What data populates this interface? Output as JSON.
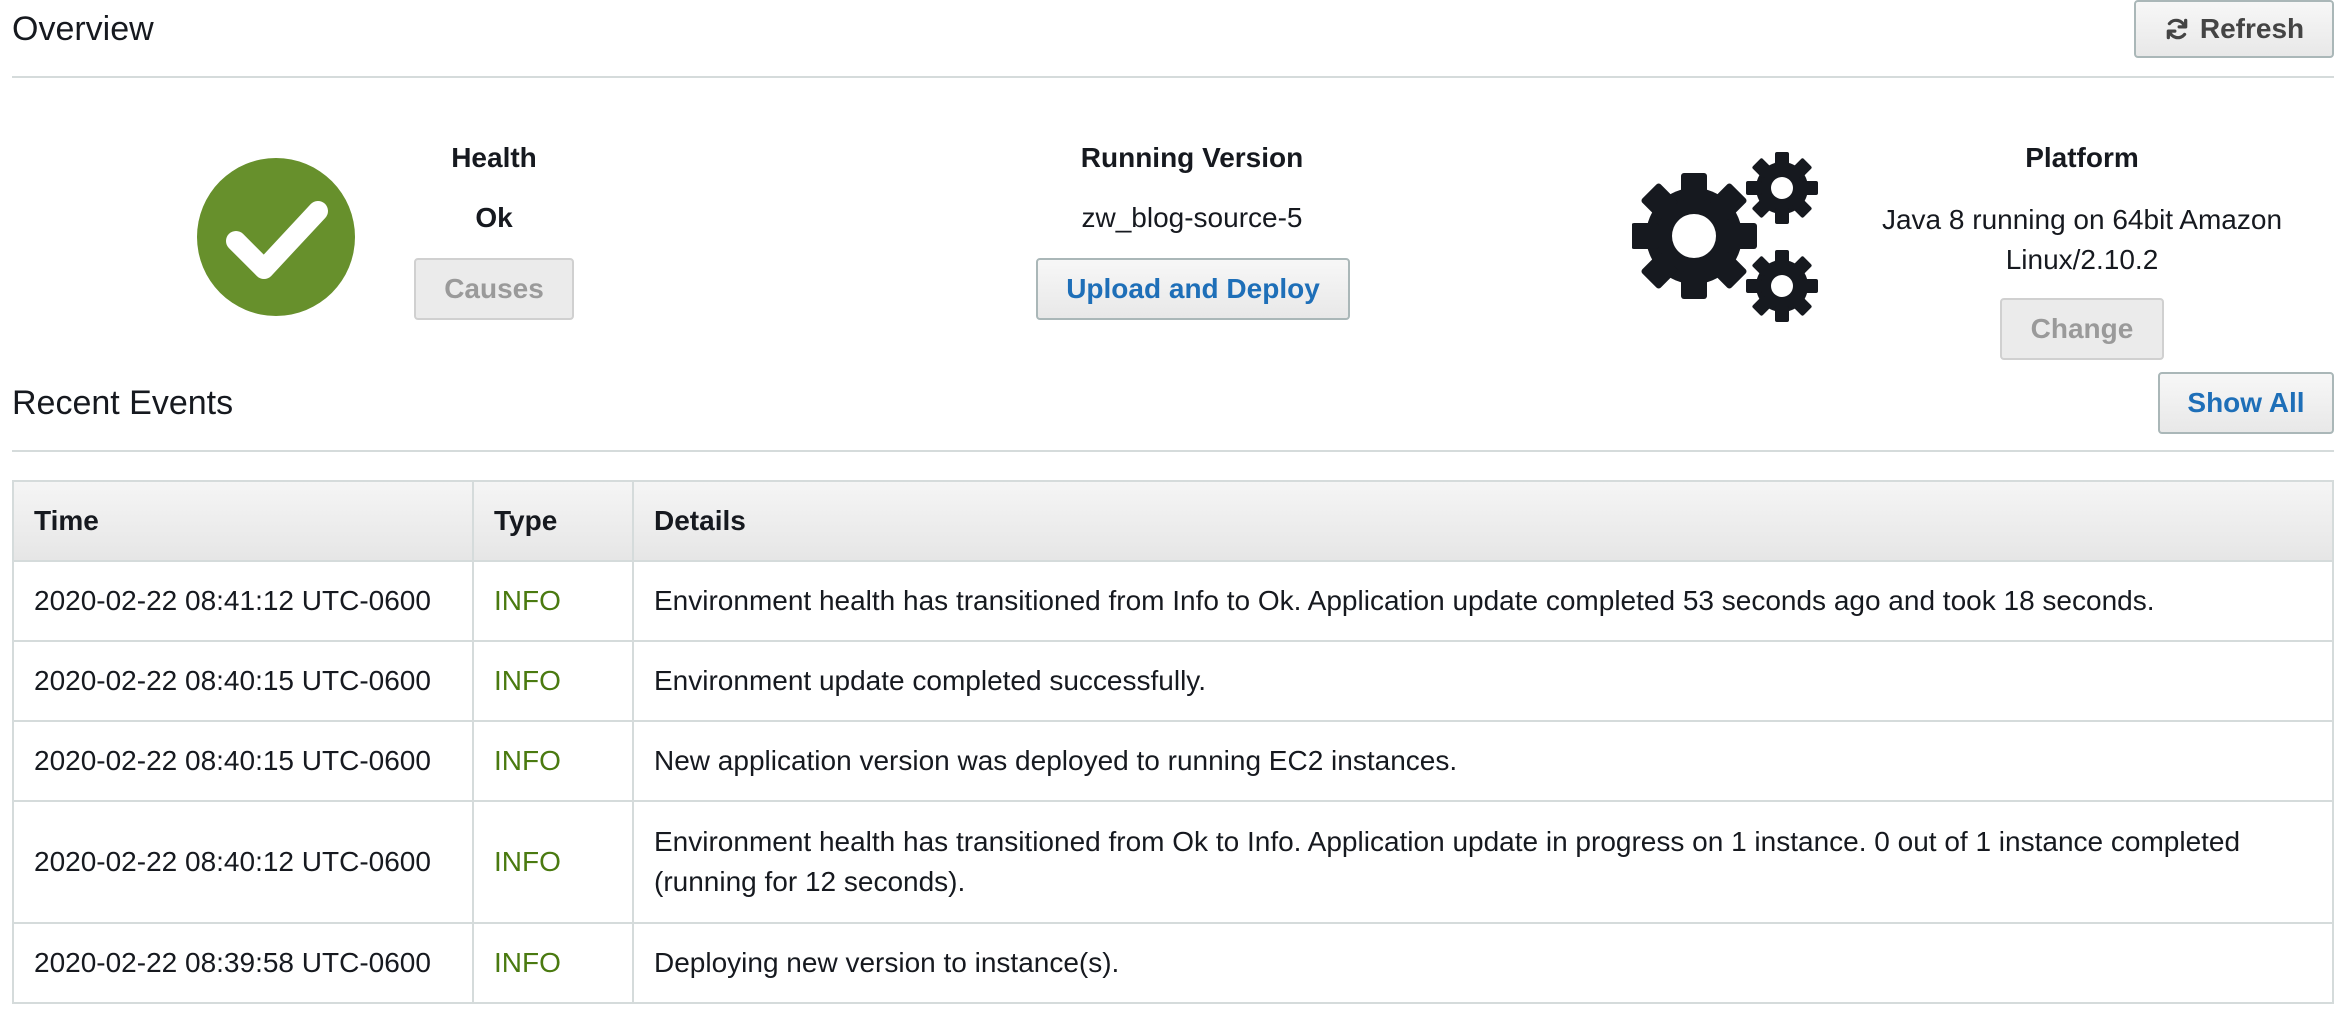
{
  "overview": {
    "title": "Overview",
    "refresh_label": "Refresh"
  },
  "health": {
    "heading": "Health",
    "status": "Ok",
    "causes_label": "Causes",
    "status_color": "#67902c"
  },
  "running_version": {
    "heading": "Running Version",
    "value": "zw_blog-source-5",
    "upload_label": "Upload and Deploy"
  },
  "platform": {
    "heading": "Platform",
    "value": "Java 8 running on 64bit Amazon Linux/2.10.2",
    "change_label": "Change"
  },
  "recent_events": {
    "title": "Recent Events",
    "show_all_label": "Show All",
    "columns": [
      "Time",
      "Type",
      "Details"
    ],
    "rows": [
      {
        "time": "2020-02-22 08:41:12 UTC-0600",
        "type": "INFO",
        "details": "Environment health has transitioned from Info to Ok. Application update completed 53 seconds ago and took 18 seconds."
      },
      {
        "time": "2020-02-22 08:40:15 UTC-0600",
        "type": "INFO",
        "details": "Environment update completed successfully."
      },
      {
        "time": "2020-02-22 08:40:15 UTC-0600",
        "type": "INFO",
        "details": "New application version was deployed to running EC2 instances."
      },
      {
        "time": "2020-02-22 08:40:12 UTC-0600",
        "type": "INFO",
        "details": "Environment health has transitioned from Ok to Info. Application update in progress on 1 instance. 0 out of 1 instance completed (running for 12 seconds)."
      },
      {
        "time": "2020-02-22 08:39:58 UTC-0600",
        "type": "INFO",
        "details": "Deploying new version to instance(s)."
      }
    ]
  },
  "icons": {
    "health": "check-circle-icon",
    "platform": "gears-icon",
    "refresh": "refresh-icon"
  },
  "colors": {
    "link_blue": "#1e6fb8",
    "info_green": "#4a7a10"
  }
}
